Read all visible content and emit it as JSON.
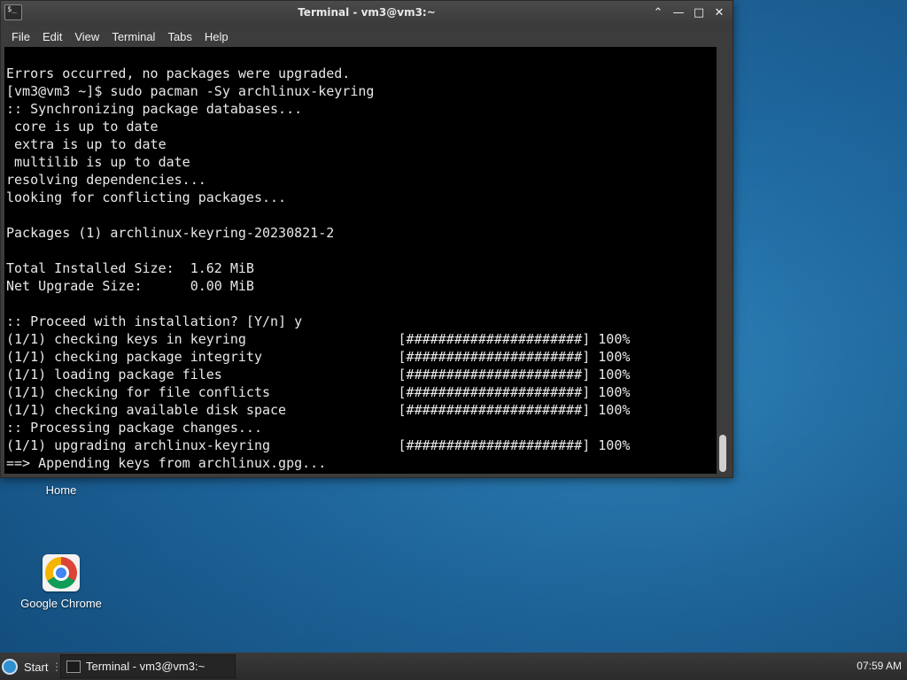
{
  "window": {
    "title": "Terminal - vm3@vm3:~",
    "app_icon_glyph": "$_",
    "controls": {
      "shade": "⌃",
      "minimize": "—",
      "maximize": "□",
      "close": "✕"
    }
  },
  "menu": [
    "File",
    "Edit",
    "View",
    "Terminal",
    "Tabs",
    "Help"
  ],
  "terminal": {
    "lines": [
      "Errors occurred, no packages were upgraded.",
      "[vm3@vm3 ~]$ sudo pacman -Sy archlinux-keyring",
      ":: Synchronizing package databases...",
      " core is up to date",
      " extra is up to date",
      " multilib is up to date",
      "resolving dependencies...",
      "looking for conflicting packages...",
      "",
      "Packages (1) archlinux-keyring-20230821-2",
      "",
      "Total Installed Size:  1.62 MiB",
      "Net Upgrade Size:      0.00 MiB",
      "",
      ":: Proceed with installation? [Y/n] y",
      "(1/1) checking keys in keyring                   [######################] 100%",
      "(1/1) checking package integrity                 [######################] 100%",
      "(1/1) loading package files                      [######################] 100%",
      "(1/1) checking for file conflicts                [######################] 100%",
      "(1/1) checking available disk space              [######################] 100%",
      ":: Processing package changes...",
      "(1/1) upgrading archlinux-keyring                [######################] 100%",
      "==> Appending keys from archlinux.gpg..."
    ]
  },
  "desktop": {
    "icons": [
      {
        "label": "Home",
        "icon": "home-folder-icon"
      },
      {
        "label": "Google Chrome",
        "icon": "chrome-icon"
      }
    ]
  },
  "taskbar": {
    "start_label": "Start",
    "separator": "⋮",
    "task_label": "Terminal - vm3@vm3:~",
    "clock": "07:59 AM"
  }
}
